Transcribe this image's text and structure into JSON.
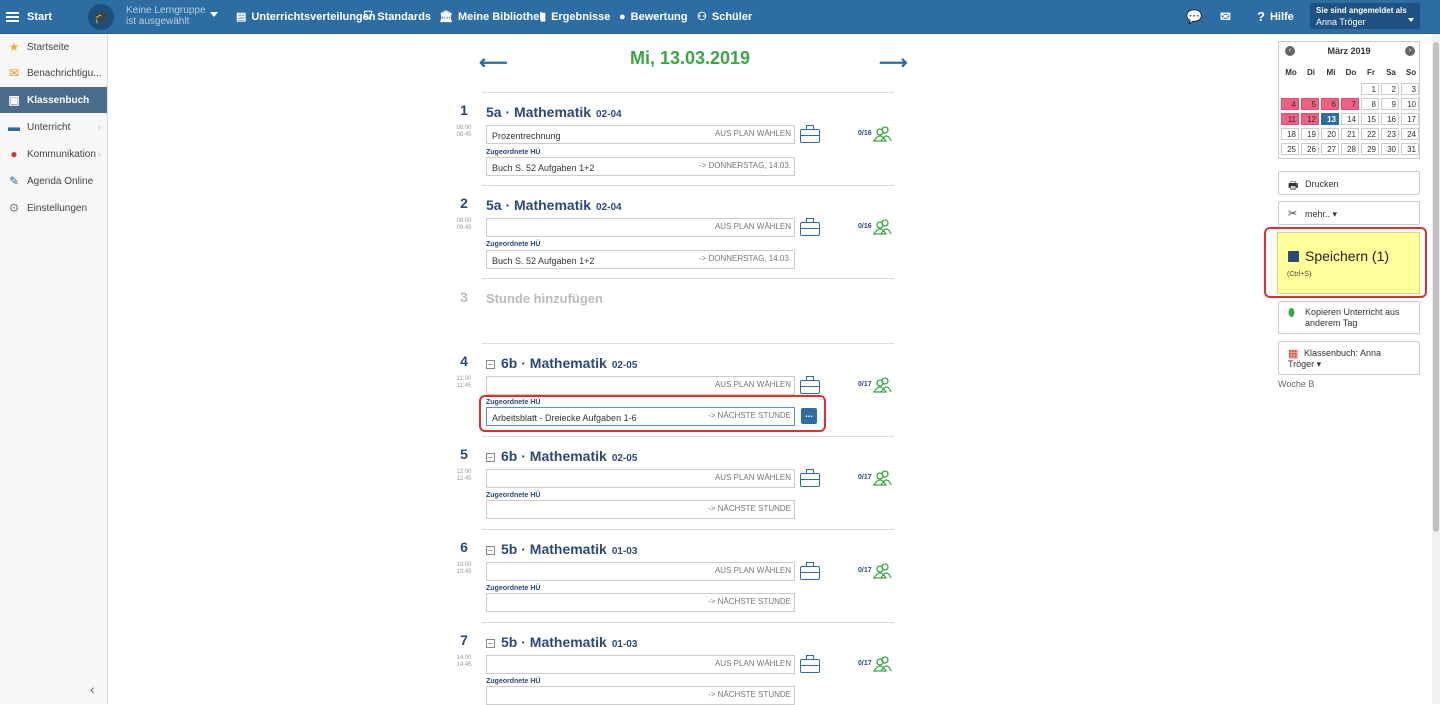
{
  "topbar": {
    "start": "Start",
    "group_line1": "Keine Lerngruppe",
    "group_line2": "ist ausgewählt",
    "nav": [
      "Unterrichtsverteilungen",
      "Standards",
      "Meine Bibliothek",
      "Ergebnisse",
      "Bewertung",
      "Schüler"
    ],
    "help": "Hilfe",
    "user_label": "Sie sind angemeldet als",
    "user_name": "Anna Tröger"
  },
  "sidebar": {
    "items": [
      {
        "label": "Startseite",
        "icon": "star-icon"
      },
      {
        "label": "Benachrichtigu...",
        "icon": "envelope-icon"
      },
      {
        "label": "Klassenbuch",
        "icon": "book-icon"
      },
      {
        "label": "Unterricht",
        "icon": "briefcase-icon"
      },
      {
        "label": "Kommunikation",
        "icon": "chat-icon"
      },
      {
        "label": "Agenda Online",
        "icon": "pen-icon"
      },
      {
        "label": "Einstellungen",
        "icon": "gear-icon"
      }
    ]
  },
  "main": {
    "date": "Mi, 13.03.2019",
    "add_lesson": "Stunde hinzufügen",
    "plan_hint": "AUS PLAN WÄHLEN",
    "hu_label": "Zugeordnete HÜ",
    "lessons": [
      {
        "num": "1",
        "t1": "08:00",
        "t2": "08:45",
        "title": "5a · Mathematik",
        "room": "02-04",
        "topic": "Prozentrechnung",
        "hu": "Buch S. 52 Aufgaben 1+2",
        "hu_hint": "-> DONNERSTAG, 14.03.",
        "count": "0/16"
      },
      {
        "num": "2",
        "t1": "09:00",
        "t2": "09:45",
        "title": "5a · Mathematik",
        "room": "02-04",
        "topic": "",
        "hu": "Buch S. 52 Aufgaben 1+2",
        "hu_hint": "-> DONNERSTAG, 14.03.",
        "count": "0/16"
      },
      {
        "num": "3"
      },
      {
        "num": "4",
        "t1": "11:00",
        "t2": "11:45",
        "title": "6b · Mathematik",
        "room": "02-05",
        "topic": "",
        "hu": "Arbeitsblatt - Dreiecke Aufgaben 1-6",
        "hu_hint": "-> NÄCHSTE STUNDE",
        "count": "0/17"
      },
      {
        "num": "5",
        "t1": "12:00",
        "t2": "12:45",
        "title": "6b · Mathematik",
        "room": "02-05",
        "topic": "",
        "hu": "",
        "hu_hint": "-> NÄCHSTE STUNDE",
        "count": "0/17"
      },
      {
        "num": "6",
        "t1": "13:00",
        "t2": "13:45",
        "title": "5b · Mathematik",
        "room": "01-03",
        "topic": "",
        "hu": "",
        "hu_hint": "-> NÄCHSTE STUNDE",
        "count": "0/17"
      },
      {
        "num": "7",
        "t1": "14:00",
        "t2": "14:45",
        "title": "5b · Mathematik",
        "room": "01-03",
        "topic": "",
        "hu": "",
        "hu_hint": "-> NÄCHSTE STUNDE",
        "count": "0/17"
      }
    ]
  },
  "calendar": {
    "month": "März 2019",
    "dow": [
      "Mo",
      "Di",
      "Mi",
      "Do",
      "Fr",
      "Sa",
      "So"
    ],
    "weeks": [
      [
        "",
        "",
        "",
        "",
        "1",
        "2",
        "3"
      ],
      [
        "4",
        "5",
        "6",
        "7",
        "8",
        "9",
        "10"
      ],
      [
        "11",
        "12",
        "13",
        "14",
        "15",
        "16",
        "17"
      ],
      [
        "18",
        "19",
        "20",
        "21",
        "22",
        "23",
        "24"
      ],
      [
        "25",
        "26",
        "27",
        "28",
        "29",
        "30",
        "31"
      ]
    ],
    "marked": [
      "4",
      "5",
      "6",
      "7",
      "11",
      "12"
    ],
    "today": "13"
  },
  "right": {
    "print": "Drucken",
    "more": "mehr.. ▾",
    "save": "Speichern (1)",
    "save_shortcut": "(Ctrl+S)",
    "copy": "Kopieren Unterricht aus anderem Tag",
    "classbook": "Klassenbuch: Anna Tröger ▾",
    "week": "Woche B"
  },
  "colors": {
    "topbar": "#2e6da4",
    "accent_green": "#3aa845",
    "highlight_red": "#e23030",
    "save_bg": "#ffff99"
  }
}
